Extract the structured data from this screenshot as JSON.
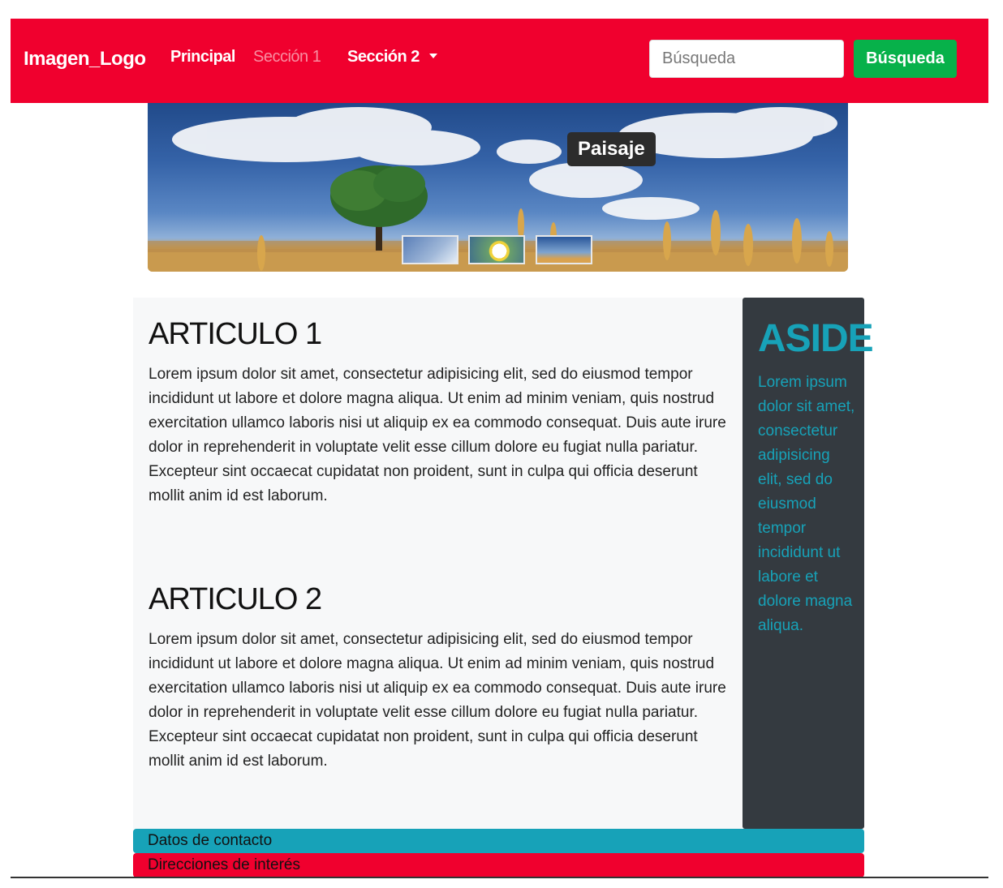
{
  "navbar": {
    "brand": "Imagen_Logo",
    "links": [
      "Principal",
      "Sección 1",
      "Sección 2"
    ],
    "search_placeholder": "Búsqueda",
    "search_button": "Búsqueda",
    "background": "#f0002e",
    "button_color": "#07b14a"
  },
  "carousel": {
    "caption": "Paisaje"
  },
  "articles": [
    {
      "title": "ARTICULO 1",
      "body": "Lorem ipsum dolor sit amet, consectetur adipisicing elit, sed do eiusmod tempor incididunt ut labore et dolore magna aliqua. Ut enim ad minim veniam, quis nostrud exercitation ullamco laboris nisi ut aliquip ex ea commodo consequat. Duis aute irure dolor in reprehenderit in voluptate velit esse cillum dolore eu fugiat nulla pariatur. Excepteur sint occaecat cupidatat non proident, sunt in culpa qui officia deserunt mollit anim id est laborum."
    },
    {
      "title": "ARTICULO 2",
      "body": "Lorem ipsum dolor sit amet, consectetur adipisicing elit, sed do eiusmod tempor incididunt ut labore et dolore magna aliqua. Ut enim ad minim veniam, quis nostrud exercitation ullamco laboris nisi ut aliquip ex ea commodo consequat. Duis aute irure dolor in reprehenderit in voluptate velit esse cillum dolore eu fugiat nulla pariatur. Excepteur sint occaecat cupidatat non proident, sunt in culpa qui officia deserunt mollit anim id est laborum."
    }
  ],
  "aside": {
    "title": "ASIDE",
    "body": "Lorem ipsum dolor sit amet, consectetur adipisicing elit, sed do eiusmod tempor incididunt ut labore et dolore magna aliqua.",
    "color": "#17a2b8"
  },
  "footer": {
    "contact": "Datos de contacto",
    "links": "Direcciones de interés"
  }
}
